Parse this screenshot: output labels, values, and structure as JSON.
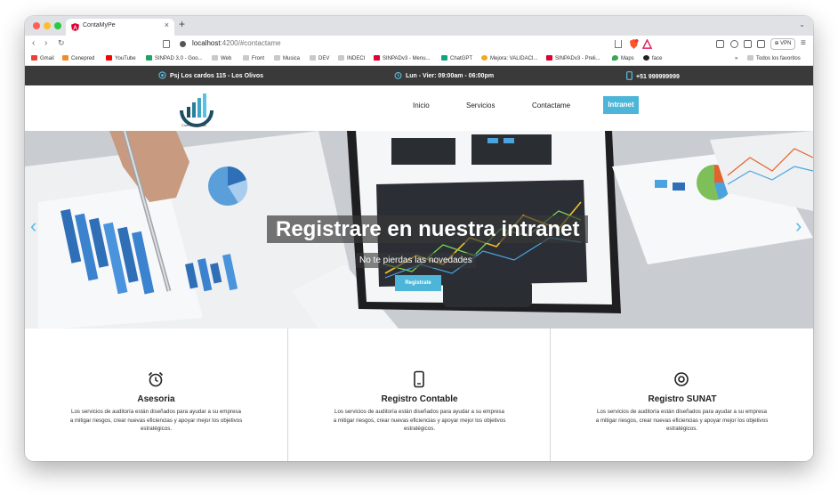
{
  "browser": {
    "tab_title": "ContaMyPe",
    "url_host": "localhost",
    "url_path": ":4200/#contactame",
    "vpn_label": "VPN",
    "bookmarks": [
      {
        "label": "Gmail",
        "icon": "gmail-icon"
      },
      {
        "label": "Cenepred",
        "icon": "cenepred-icon"
      },
      {
        "label": "YouTube",
        "icon": "youtube-icon"
      },
      {
        "label": "SINPAD 3.0 - Goo...",
        "icon": "drive-icon"
      },
      {
        "label": "Web",
        "icon": "folder-icon"
      },
      {
        "label": "Front",
        "icon": "folder-icon"
      },
      {
        "label": "Musica",
        "icon": "folder-icon"
      },
      {
        "label": "DEV",
        "icon": "folder-icon"
      },
      {
        "label": "INDECI",
        "icon": "folder-icon"
      },
      {
        "label": "SINPADv3 - Menu...",
        "icon": "angular-icon"
      },
      {
        "label": "ChatGPT",
        "icon": "chatgpt-icon"
      },
      {
        "label": "Mejora: VALIDACI...",
        "icon": "mejora-icon"
      },
      {
        "label": "SINPADv3 - Preli...",
        "icon": "angular-icon"
      },
      {
        "label": "Maps",
        "icon": "maps-icon"
      },
      {
        "label": "face",
        "icon": "github-icon"
      }
    ],
    "bookmarks_overflow": "»",
    "all_bookmarks_label": "Todos los favoritos"
  },
  "topbar": {
    "address": "Psj Los cardos 115 - Los Olivos",
    "hours": "Lun - Vier: 09:00am - 06:00pm",
    "phone": "+51 999999999"
  },
  "nav": {
    "logo_text": "Cuentas Claras",
    "links": [
      "Inicio",
      "Servicios",
      "Contactame"
    ],
    "cta": "Intranet"
  },
  "hero": {
    "title": "Registrare en nuestra intranet",
    "subtitle": "No te pierdas las novedades",
    "button": "Registrate"
  },
  "services": [
    {
      "icon": "alarm-clock-icon",
      "title": "Asesoria",
      "text": "Los servicios de auditoría están diseñados para ayudar a su empresa a mitigar riesgos, crear nuevas eficiencias y apoyar mejor los objetivos estratégicos."
    },
    {
      "icon": "mobile-phone-icon",
      "title": "Registro Contable",
      "text": "Los servicios de auditoría están diseñados para ayudar a su empresa a mitigar riesgos, crear nuevas eficiencias y apoyar mejor los objetivos estratégicos."
    },
    {
      "icon": "location-pin-icon",
      "title": "Registro SUNAT",
      "text": "Los servicios de auditoría están diseñados para ayudar a su empresa a mitigar riesgos, crear nuevas eficiencias y apoyar mejor los objetivos estratégicos."
    }
  ],
  "colors": {
    "accent": "#4db6d8",
    "topbar_bg": "#3a3a3a",
    "carousel_arrow": "#58b9e6"
  }
}
